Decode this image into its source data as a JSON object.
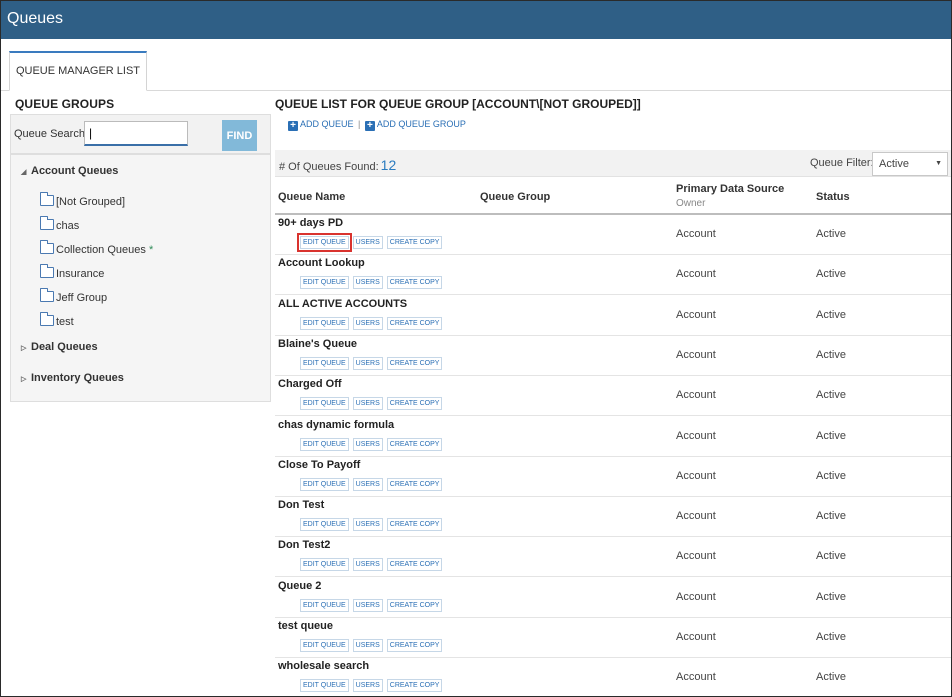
{
  "app": {
    "title": "Queues"
  },
  "tabs": [
    {
      "label": "QUEUE MANAGER LIST"
    }
  ],
  "left_panel": {
    "title": "QUEUE GROUPS",
    "search_label": "Queue Search:",
    "search_value": "|",
    "find_label": "FIND",
    "tree": {
      "account_queues": {
        "label": "Account Queues",
        "children": [
          "[Not Grouped]",
          "chas",
          "Collection Queues",
          "Insurance",
          "Jeff Group",
          "test"
        ],
        "marker": "*"
      },
      "deal_queues": {
        "label": "Deal Queues"
      },
      "inventory_queues": {
        "label": "Inventory Queues"
      }
    }
  },
  "right_panel": {
    "title": "QUEUE LIST FOR QUEUE GROUP [ACCOUNT\\[NOT GROUPED]]",
    "add_queue": "ADD QUEUE",
    "separator": "|",
    "add_queue_group": "ADD QUEUE GROUP",
    "count_label": "# Of Queues Found:",
    "count_value": "12",
    "filter_label": "Queue Filter:",
    "filter_value": "Active",
    "columns": {
      "queue_name": "Queue Name",
      "queue_group": "Queue Group",
      "primary_source": "Primary Data Source",
      "owner": "Owner",
      "status": "Status"
    },
    "row_buttons": {
      "edit": "EDIT QUEUE",
      "users": "USERS",
      "copy": "CREATE COPY"
    },
    "rows": [
      {
        "name": "90+ days PD",
        "source": "Account",
        "status": "Active"
      },
      {
        "name": "Account Lookup",
        "source": "Account",
        "status": "Active"
      },
      {
        "name": "ALL ACTIVE ACCOUNTS",
        "source": "Account",
        "status": "Active"
      },
      {
        "name": "Blaine's Queue",
        "source": "Account",
        "status": "Active"
      },
      {
        "name": "Charged Off",
        "source": "Account",
        "status": "Active"
      },
      {
        "name": "chas dynamic formula",
        "source": "Account",
        "status": "Active"
      },
      {
        "name": "Close To Payoff",
        "source": "Account",
        "status": "Active"
      },
      {
        "name": "Don Test",
        "source": "Account",
        "status": "Active"
      },
      {
        "name": "Don Test2",
        "source": "Account",
        "status": "Active"
      },
      {
        "name": "Queue 2",
        "source": "Account",
        "status": "Active"
      },
      {
        "name": "test queue",
        "source": "Account",
        "status": "Active"
      },
      {
        "name": "wholesale search",
        "source": "Account",
        "status": "Active"
      }
    ]
  },
  "colors": {
    "header_bg": "#2f5f86",
    "accent": "#2a6fb5",
    "find_btn": "#82b9d9",
    "highlight": "#d9332e"
  }
}
